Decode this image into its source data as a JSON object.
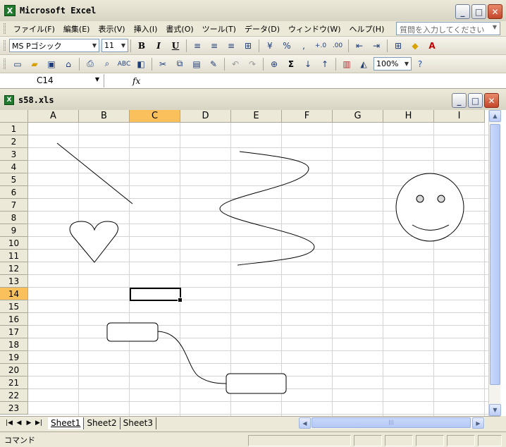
{
  "app": {
    "title": "Microsoft Excel"
  },
  "menubar": {
    "items": [
      "ファイル(F)",
      "編集(E)",
      "表示(V)",
      "挿入(I)",
      "書式(O)",
      "ツール(T)",
      "データ(D)",
      "ウィンドウ(W)",
      "ヘルプ(H)"
    ],
    "help_placeholder": "質問を入力してください"
  },
  "formatting_toolbar": {
    "font": "MS Pゴシック",
    "font_size": "11",
    "buttons": {
      "bold": "B",
      "italic": "I",
      "underline": "U",
      "percent": "%",
      "comma": ","
    }
  },
  "standard_toolbar": {
    "zoom": "100%",
    "sum": "Σ"
  },
  "formula_bar": {
    "cell_ref": "C14",
    "fx": "fx",
    "content": ""
  },
  "workbook": {
    "title": "s58.xls"
  },
  "grid": {
    "columns": [
      "A",
      "B",
      "C",
      "D",
      "E",
      "F",
      "G",
      "H",
      "I"
    ],
    "rows": [
      "1",
      "2",
      "3",
      "4",
      "5",
      "6",
      "7",
      "8",
      "9",
      "10",
      "11",
      "12",
      "13",
      "14",
      "15",
      "16",
      "17",
      "18",
      "19",
      "20",
      "21",
      "22",
      "23"
    ],
    "selected_column": "C",
    "selected_row": "14"
  },
  "shapes": [
    "line",
    "heart",
    "curve",
    "smiley-face",
    "rounded-rectangle",
    "rounded-rectangle",
    "curved-connector"
  ],
  "sheet_tabs": [
    "Sheet1",
    "Sheet2",
    "Sheet3"
  ],
  "active_sheet": "Sheet1",
  "status": {
    "text": "コマンド"
  },
  "colors": {
    "selection_header": "#f9c05c",
    "grid": "#d4d4d4",
    "chrome": "#ece9d8"
  }
}
